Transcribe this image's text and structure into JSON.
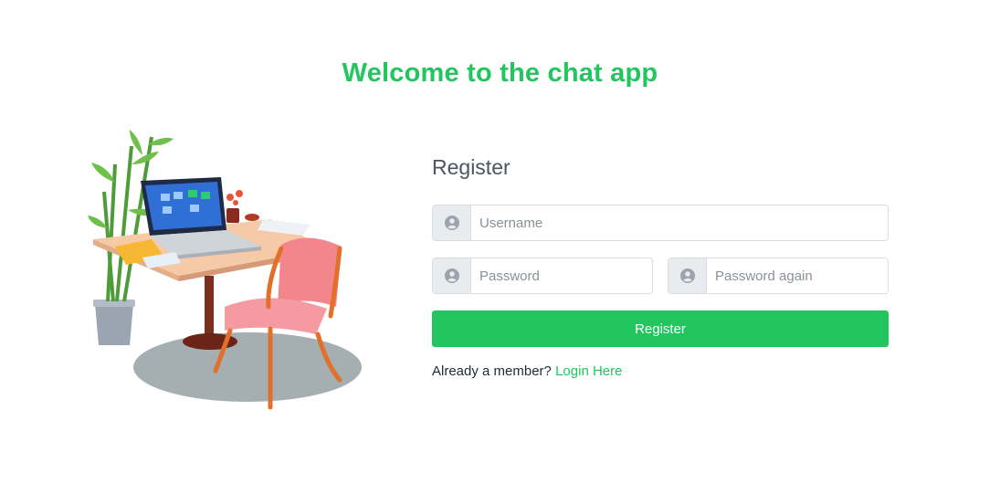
{
  "header": {
    "title": "Welcome to the chat app"
  },
  "form": {
    "title": "Register",
    "username": {
      "placeholder": "Username",
      "value": ""
    },
    "password": {
      "placeholder": "Password",
      "value": ""
    },
    "password_again": {
      "placeholder": "Password again",
      "value": ""
    },
    "submit_label": "Register",
    "login_prompt": "Already a member?",
    "login_link": "Login Here"
  },
  "icons": {
    "field_icon": "user-circle-icon"
  },
  "colors": {
    "accent": "#22c55e",
    "addon_bg": "#e9ecef",
    "border": "#d9dde3"
  }
}
